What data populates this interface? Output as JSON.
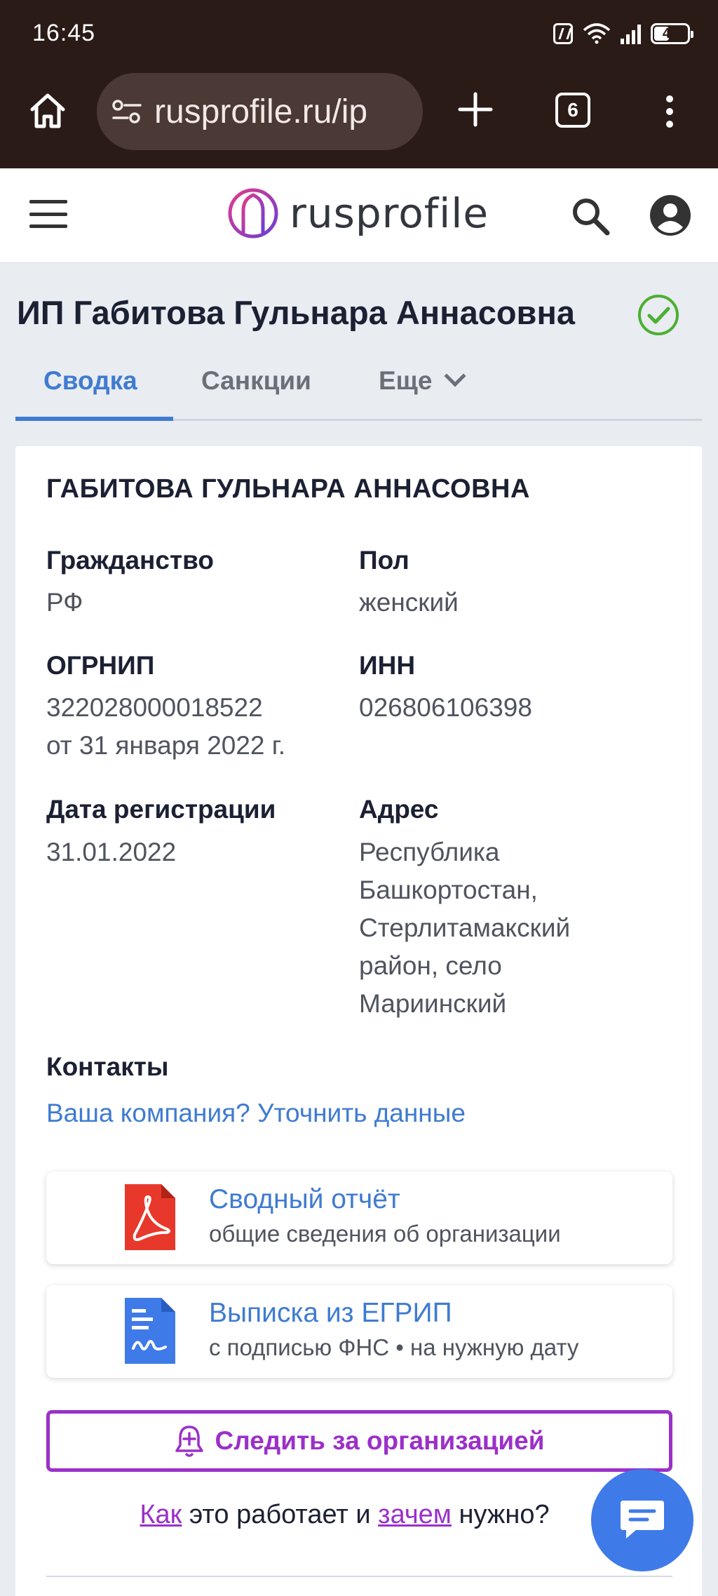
{
  "status_bar": {
    "time": "16:45",
    "battery_level": "45",
    "battery_fraction": 0.45
  },
  "browser": {
    "url": "rusprofile.ru/ip",
    "tab_count": "6"
  },
  "site": {
    "logo_text": "rusprofile"
  },
  "page": {
    "title": "ИП Габитова Гульнара Аннасовна"
  },
  "tabs": [
    {
      "label": "Сводка",
      "active": true
    },
    {
      "label": "Санкции",
      "active": false
    },
    {
      "label": "Еще",
      "active": false
    }
  ],
  "card": {
    "name": "ГАБИТОВА ГУЛЬНАРА АННАСОВНА",
    "citizenship_label": "Гражданство",
    "citizenship_value": "РФ",
    "gender_label": "Пол",
    "gender_value": "женский",
    "ogrnip_label": "ОГРНИП",
    "ogrnip_value": "322028000018522",
    "ogrnip_date": "от 31 января 2022 г.",
    "inn_label": "ИНН",
    "inn_value": "026806106398",
    "reg_date_label": "Дата регистрации",
    "reg_date_value": "31.01.2022",
    "address_label": "Адрес",
    "address_lines": [
      "Республика",
      "Башкортостан,",
      "Стерлитамакский",
      "район, село",
      "Мариинский"
    ],
    "contacts_label": "Контакты",
    "contacts_link": "Ваша компания? Уточнить данные"
  },
  "docs": [
    {
      "title": "Сводный отчёт",
      "subtitle": "общие сведения об организации",
      "icon": "pdf-icon",
      "color": "#e8382b"
    },
    {
      "title": "Выписка из ЕГРИП",
      "subtitle": "с подписью ФНС • на нужную дату",
      "icon": "signed-document-icon",
      "color": "#3f7ae9"
    }
  ],
  "follow": {
    "label": "Следить за организацией",
    "icon": "bell-plus-icon",
    "color": "#9b30c9"
  },
  "how": {
    "link1": "Как",
    "text1": " это работает и ",
    "link2": "зачем",
    "text2": " нужно?"
  },
  "colors": {
    "accent_blue": "#3f7bd1",
    "success_green": "#4caf32",
    "chrome_bg": "#2b1b17"
  }
}
